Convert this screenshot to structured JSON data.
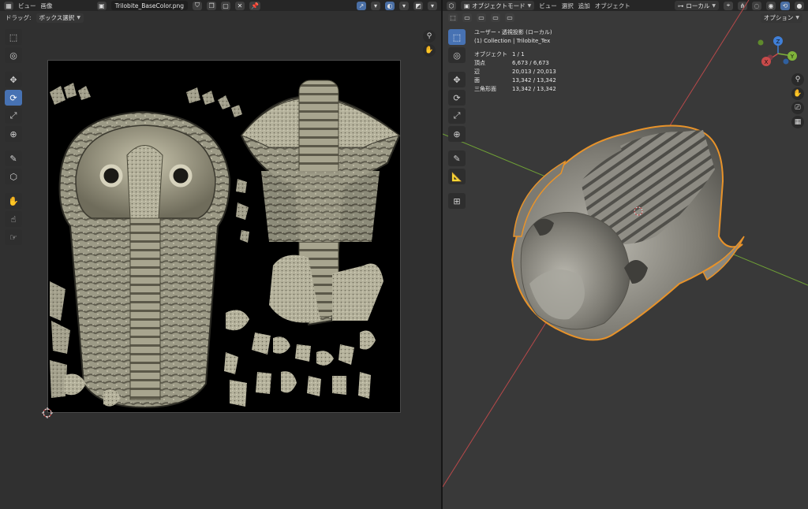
{
  "uv_editor": {
    "header": {
      "menus": [
        "ビュー",
        "画像"
      ],
      "image_name": "Trilobite_BaseColor.png"
    },
    "subheader": {
      "drag_label": "ドラッグ:",
      "drag_mode": "ボックス選択"
    }
  },
  "viewport": {
    "header": {
      "mode": "オブジェクトモード",
      "menus": [
        "ビュー",
        "選択",
        "追加",
        "オブジェクト"
      ],
      "transform_orientation": "ローカル",
      "options_label": "オプション"
    },
    "info": {
      "view_name": "ユーザー・透視投影 (ローカル)",
      "collection": "(1) Collection | Trilobite_Tex",
      "stats": [
        {
          "label": "オブジェクト",
          "value": "1 / 1"
        },
        {
          "label": "頂点",
          "value": "6,673 / 6,673"
        },
        {
          "label": "辺",
          "value": "20,013 / 20,013"
        },
        {
          "label": "面",
          "value": "13,342 / 13,342"
        },
        {
          "label": "三角形面",
          "value": "13,342 / 13,342"
        }
      ]
    },
    "gizmo": {
      "x": "X",
      "y": "Y",
      "z": "Z"
    }
  },
  "colors": {
    "accent": "#4772b3",
    "selection_outline": "#e8932a",
    "axis_x": "#c84a4a",
    "axis_y": "#7fb33a",
    "axis_z": "#3f7fd8"
  }
}
